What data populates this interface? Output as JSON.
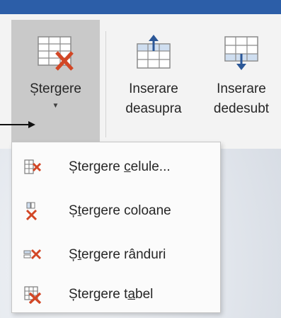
{
  "ribbon": {
    "delete_label": "Ștergere",
    "insert_above_line1": "Inserare",
    "insert_above_line2": "deasupra",
    "insert_below_line1": "Inserare",
    "insert_below_line2": "dedesubt"
  },
  "menu": {
    "items": [
      {
        "pre": "Ștergere ",
        "ul": "c",
        "post": "elule...",
        "icon": "delete-cells-icon"
      },
      {
        "pre": "Ș",
        "ul": "t",
        "post": "ergere coloane",
        "icon": "delete-columns-icon"
      },
      {
        "pre": "Ș",
        "ul": "t",
        "post": "ergere rânduri",
        "icon": "delete-rows-icon"
      },
      {
        "pre": "Ștergere t",
        "ul": "a",
        "post": "bel",
        "icon": "delete-table-icon"
      }
    ]
  },
  "colors": {
    "titlebar": "#2c5ea8",
    "delete_x": "#d24726",
    "insert_arrow": "#2b5797",
    "active_button": "#c9c9c9"
  }
}
